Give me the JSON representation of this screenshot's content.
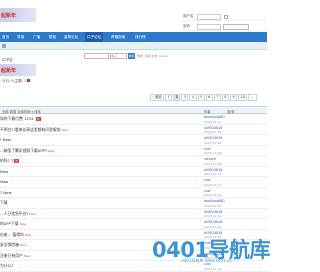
{
  "header": {
    "logo_text": "起新年",
    "login": {
      "user_label": "用户名",
      "pass_label": "密码"
    }
  },
  "nav": {
    "items": [
      "首页",
      "导读",
      "广播",
      "群组",
      "香草论坛",
      "口子论坛",
      "荐赚指南",
      "排行榜"
    ]
  },
  "search": {
    "scope": "帖子",
    "button": "搜索",
    "hot": "热搜: 活动 交友 discuz"
  },
  "breadcrumb": "口子论",
  "forum": {
    "name": "起新年",
    "stats": "今日: 0|主题: 1"
  },
  "pager": {
    "prev": "‹ 返回",
    "pages": [
      "1",
      "2",
      "3",
      "4",
      "5",
      "6",
      "7",
      "8",
      "9",
      "10",
      "..."
    ],
    "current": "2"
  },
  "table_head": {
    "filter": "全部 新窗 全部时间 ▾ 排序",
    "author_col": "作者",
    "replies_col": "回/查"
  },
  "threads": [
    {
      "title": "如何下载付费 1234 ",
      "badge": "新",
      "new": "",
      "author": "baoXiong881",
      "date": "2023-12-19"
    },
    {
      "title": "不明白?!看来长高这里都有问答服务",
      "badge": "",
      "new": "New",
      "author": "a09524818",
      "date": "2023-12-18"
    },
    {
      "title": "! New",
      "badge": "",
      "new": "",
      "author": "a09524818",
      "date": "2023-12-18"
    },
    {
      "title": "...新版了腾讯视频下载APP?",
      "badge": "",
      "new": "New",
      "author": "cool",
      "date": "2023-12-18"
    },
    {
      "title": "的吗? 7",
      "badge": "新",
      "new": "",
      "author": "steam0",
      "date": "2023-12-18"
    },
    {
      "title": "New",
      "badge": "",
      "new": "",
      "author": "a09524818",
      "date": "2023-12-17"
    },
    {
      "title": "New",
      "badge": "",
      "new": "",
      "author": "cool",
      "date": "2023-12-17"
    },
    {
      "title": "? New",
      "badge": "",
      "new": "",
      "author": "cool",
      "date": "2023-12-16"
    },
    {
      "title": "下载",
      "badge": "",
      "new": "",
      "author": "baoXiong881",
      "date": "2023-12-16"
    },
    {
      "title": "...人已找到平台?",
      "badge": "",
      "new": "New",
      "author": "a09524818",
      "date": "2023-12-16"
    },
    {
      "title": "的APP下载",
      "badge": "",
      "new": "New",
      "author": "a09524818",
      "date": "2023-12-16"
    },
    {
      "title": "出来... 值得吗",
      "badge": "",
      "new": "New",
      "author": "a09524818",
      "date": "2023-12-16"
    },
    {
      "title": "安全保险箱",
      "badge": "",
      "new": "New",
      "author": "cool",
      "date": "2023-12-15"
    },
    {
      "title": "注册已有用户",
      "badge": "",
      "new": "New",
      "author": "a09524818",
      "date": "2023-12-15"
    },
    {
      "title": "为什么?",
      "badge": "",
      "new": "",
      "author": "cool",
      "date": "2023-12-15"
    }
  ],
  "watermark": {
    "name": "0401导航库",
    "tagline": "0401导航库 www.0401.cn"
  }
}
